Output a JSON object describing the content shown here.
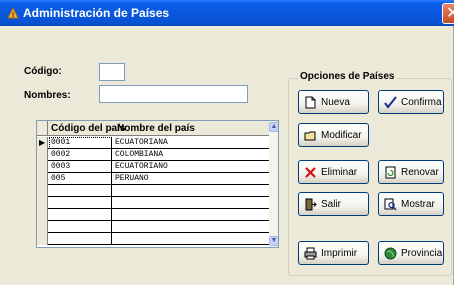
{
  "window": {
    "title": "Administración de Países"
  },
  "form": {
    "codigo_label": "Código:",
    "codigo_value": "",
    "nombres_label": "Nombres:",
    "nombres_value": ""
  },
  "options": {
    "legend": "Opciones de Países",
    "buttons": {
      "nueva": "Nueva",
      "confirma": "Confirma",
      "modificar": "Modificar",
      "eliminar": "Eliminar",
      "renovar": "Renovar",
      "salir": "Salir",
      "mostrar": "Mostrar",
      "imprimir": "Imprimir",
      "provincia": "Provincia"
    }
  },
  "grid": {
    "columns": [
      "Código del país",
      "Nombre del país"
    ],
    "rows": [
      {
        "codigo": "0001",
        "nombre": "ECUATORIANA"
      },
      {
        "codigo": "0002",
        "nombre": "COLOMBIANA"
      },
      {
        "codigo": "0003",
        "nombre": "ECUATORIANO"
      },
      {
        "codigo": "005",
        "nombre": "PERUANO"
      },
      {
        "codigo": "",
        "nombre": ""
      },
      {
        "codigo": "",
        "nombre": ""
      },
      {
        "codigo": "",
        "nombre": ""
      },
      {
        "codigo": "",
        "nombre": ""
      },
      {
        "codigo": "",
        "nombre": ""
      }
    ],
    "selected_row_index": 0
  },
  "colors": {
    "titlebar": "#0a58df",
    "window_bg": "#ece9d8",
    "button_border": "#003c74"
  }
}
